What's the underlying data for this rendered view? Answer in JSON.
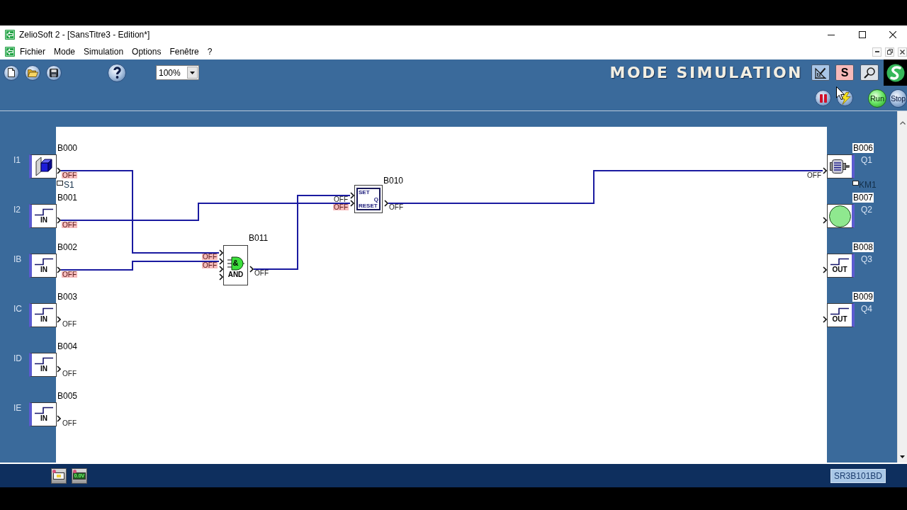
{
  "window": {
    "title": "ZelioSoft 2 - [SansTitre3 - Edition*]"
  },
  "menu": {
    "items": [
      "Fichier",
      "Mode",
      "Simulation",
      "Options",
      "Fenêtre",
      "?"
    ]
  },
  "toolbar": {
    "zoom": "100%",
    "mode_banner": "MODE SIMULATION",
    "mode_buttons": [
      {
        "kind": "edit",
        "selected": false
      },
      {
        "kind": "simulation",
        "label": "S",
        "selected": true
      },
      {
        "kind": "monitoring",
        "selected": false
      }
    ]
  },
  "simulation_bar": {
    "buttons": [
      {
        "kind": "pause"
      },
      {
        "kind": "power"
      },
      {
        "kind": "run",
        "label": "Run"
      },
      {
        "kind": "stop",
        "label": "Stop"
      }
    ]
  },
  "diagram": {
    "inputs": [
      {
        "terminal": "I1",
        "block": "B000",
        "kind": "pushbutton",
        "output": {
          "state": "OFF",
          "highlighted": true
        },
        "tag": "S1"
      },
      {
        "terminal": "I2",
        "block": "B001",
        "kind": "digital",
        "caption": "IN",
        "output": {
          "state": "OFF",
          "highlighted": true
        }
      },
      {
        "terminal": "IB",
        "block": "B002",
        "kind": "digital",
        "caption": "IN",
        "output": {
          "state": "OFF",
          "highlighted": true
        }
      },
      {
        "terminal": "IC",
        "block": "B003",
        "kind": "digital",
        "caption": "IN",
        "output": {
          "state": "OFF",
          "highlighted": false
        }
      },
      {
        "terminal": "ID",
        "block": "B004",
        "kind": "digital",
        "caption": "IN",
        "output": {
          "state": "OFF",
          "highlighted": false
        }
      },
      {
        "terminal": "IE",
        "block": "B005",
        "kind": "digital",
        "caption": "IN",
        "output": {
          "state": "OFF",
          "highlighted": false
        }
      }
    ],
    "function_blocks": [
      {
        "block": "B010",
        "kind": "set_reset",
        "symbol": [
          "SET",
          "Q",
          "RESET"
        ],
        "inputs": [
          {
            "state": "OFF",
            "highlighted": false
          },
          {
            "state": "OFF",
            "highlighted": true
          }
        ],
        "output": {
          "state": "OFF",
          "highlighted": false
        }
      },
      {
        "block": "B011",
        "kind": "and",
        "symbol": [
          "&"
        ],
        "caption": "AND",
        "inputs": [
          {
            "state": "OFF",
            "highlighted": true
          },
          {
            "state": "OFF",
            "highlighted": true
          }
        ],
        "output": {
          "state": "OFF",
          "highlighted": false
        }
      }
    ],
    "outputs": [
      {
        "terminal": "Q1",
        "block": "B006",
        "kind": "motor",
        "input": {
          "state": "OFF",
          "highlighted": false
        },
        "tag": "KM1"
      },
      {
        "terminal": "Q2",
        "block": "B007",
        "kind": "lamp"
      },
      {
        "terminal": "Q3",
        "block": "B008",
        "kind": "digital",
        "caption": "OUT"
      },
      {
        "terminal": "Q4",
        "block": "B009",
        "kind": "digital",
        "caption": "OUT"
      }
    ]
  },
  "status_bar": {
    "display": "0.0V",
    "module": "SR3B101BD"
  }
}
